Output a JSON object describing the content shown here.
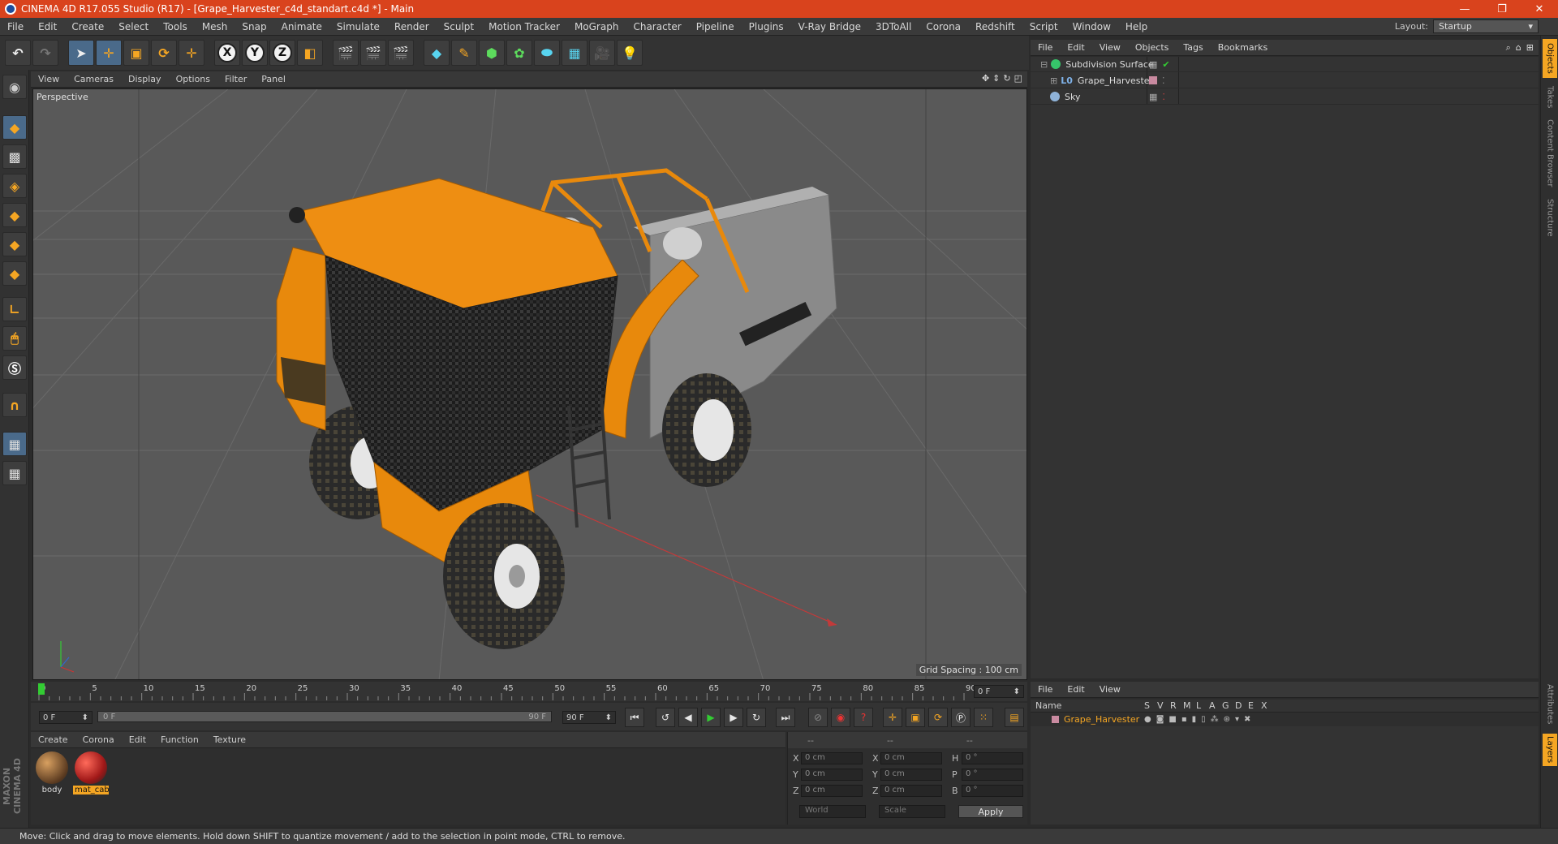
{
  "titlebar": {
    "title": "CINEMA 4D R17.055 Studio (R17) - [Grape_Harvester_c4d_standart.c4d *] - Main",
    "minimize": "—",
    "maximize": "❐",
    "close": "✕"
  },
  "menubar": {
    "items": [
      "File",
      "Edit",
      "Create",
      "Select",
      "Tools",
      "Mesh",
      "Snap",
      "Animate",
      "Simulate",
      "Render",
      "Sculpt",
      "Motion Tracker",
      "MoGraph",
      "Character",
      "Pipeline",
      "Plugins",
      "V-Ray Bridge",
      "3DToAll",
      "Corona",
      "Redshift",
      "Script",
      "Window",
      "Help"
    ],
    "layout_label": "Layout:",
    "layout_value": "Startup"
  },
  "toolbar": {
    "axis_x": "X",
    "axis_y": "Y",
    "axis_z": "Z"
  },
  "viewport": {
    "menu": [
      "View",
      "Cameras",
      "Display",
      "Options",
      "Filter",
      "Panel"
    ],
    "label": "Perspective",
    "grid_spacing": "Grid Spacing : 100 cm"
  },
  "timeline": {
    "ticks": [
      "0",
      "5",
      "10",
      "15",
      "20",
      "25",
      "30",
      "35",
      "40",
      "45",
      "50",
      "55",
      "60",
      "65",
      "70",
      "75",
      "80",
      "85",
      "90"
    ],
    "current_frame": "0 F",
    "start": "0 F",
    "range_start": "0 F",
    "range_end": "90 F",
    "end": "90 F"
  },
  "materials": {
    "menu": [
      "Create",
      "Corona",
      "Edit",
      "Function",
      "Texture"
    ],
    "items": [
      {
        "name": "body",
        "selected": false
      },
      {
        "name": "mat_cab",
        "selected": true
      }
    ]
  },
  "coordinates": {
    "headers": [
      "--",
      "--",
      "--"
    ],
    "rows": [
      {
        "a": "X",
        "av": "0 cm",
        "b": "X",
        "bv": "0 cm",
        "c": "H",
        "cv": "0 °"
      },
      {
        "a": "Y",
        "av": "0 cm",
        "b": "Y",
        "bv": "0 cm",
        "c": "P",
        "cv": "0 °"
      },
      {
        "a": "Z",
        "av": "0 cm",
        "b": "Z",
        "bv": "0 cm",
        "c": "B",
        "cv": "0 °"
      }
    ],
    "mode": "World",
    "scale_mode": "Scale",
    "apply": "Apply"
  },
  "object_manager": {
    "menu": [
      "File",
      "Edit",
      "View",
      "Objects",
      "Tags",
      "Bookmarks"
    ],
    "objects": [
      {
        "name": "Subdivision Surface",
        "color": "#36c46a"
      },
      {
        "name": "Grape_Harvester",
        "color": "#7fb2e8"
      },
      {
        "name": "Sky",
        "color": "#8fb3d9"
      }
    ]
  },
  "layer_manager": {
    "menu": [
      "File",
      "Edit",
      "View"
    ],
    "columns": [
      "Name",
      "S",
      "V",
      "R",
      "M",
      "L",
      "A",
      "G",
      "D",
      "E",
      "X"
    ],
    "layer_name": "Grape_Harvester",
    "layer_color": "#c98aa0"
  },
  "right_tabs": [
    "Objects",
    "Takes",
    "Content Browser",
    "Structure",
    "Attributes",
    "Layers"
  ],
  "status": "Move: Click and drag to move elements. Hold down SHIFT to quantize movement / add to the selection in point mode, CTRL to remove.",
  "brand": "MAXON CINEMA 4D",
  "colors": {
    "accent": "#f5a623",
    "titlebar": "#d9431d",
    "viewport_bg": "#595959"
  }
}
